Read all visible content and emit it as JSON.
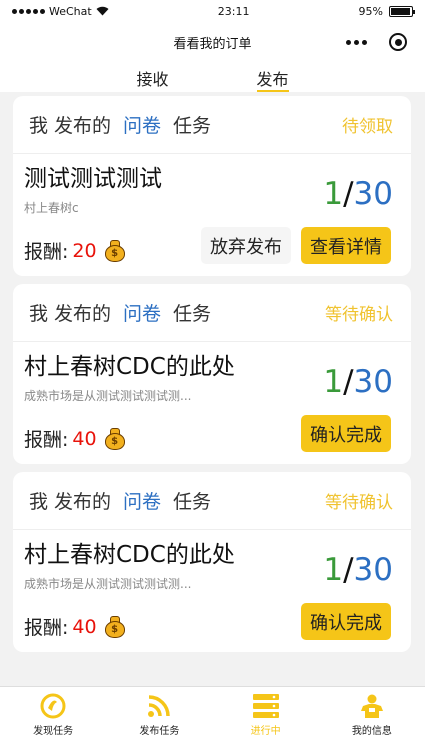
{
  "status_bar": {
    "carrier": "WeChat",
    "time": "23:11",
    "battery": "95%",
    "battery_level": 0.95
  },
  "nav": {
    "title": "看看我的订单"
  },
  "top_tabs": [
    {
      "label": "接收",
      "active": false
    },
    {
      "label": "发布",
      "active": true
    }
  ],
  "cards": [
    {
      "head": {
        "w1": "我",
        "w2": "发布的",
        "w3": "问卷",
        "w4": "任务",
        "status": "待领取"
      },
      "title": "测试测试测试",
      "subtitle": "村上春树c",
      "progress": {
        "done": "1",
        "slash": "/",
        "total": "30"
      },
      "reward_label": "报酬:",
      "reward_amount": "20",
      "buttons": [
        "放弃发布",
        "查看详情"
      ]
    },
    {
      "head": {
        "w1": "我",
        "w2": "发布的",
        "w3": "问卷",
        "w4": "任务",
        "status": "等待确认"
      },
      "title": "村上春树CDC的此处",
      "subtitle": "成熟市场是从测试测试测试测...",
      "progress": {
        "done": "1",
        "slash": "/",
        "total": "30"
      },
      "reward_label": "报酬:",
      "reward_amount": "40",
      "buttons": [
        "确认完成"
      ]
    },
    {
      "head": {
        "w1": "我",
        "w2": "发布的",
        "w3": "问卷",
        "w4": "任务",
        "status": "等待确认"
      },
      "title": "村上春树CDC的此处",
      "subtitle": "成熟市场是从测试测试测试测...",
      "progress": {
        "done": "1",
        "slash": "/",
        "total": "30"
      },
      "reward_label": "报酬:",
      "reward_amount": "40",
      "buttons": [
        "确认完成"
      ]
    }
  ],
  "tab_bar": [
    {
      "label": "发现任务",
      "icon": "discover-icon",
      "active": false
    },
    {
      "label": "发布任务",
      "icon": "rss-icon",
      "active": false
    },
    {
      "label": "进行中",
      "icon": "server-icon",
      "active": true
    },
    {
      "label": "我的信息",
      "icon": "profile-icon",
      "active": false
    }
  ],
  "colors": {
    "accent": "#f5c518",
    "blue": "#2c6fc2",
    "green": "#3a9a3a",
    "red": "#e8130b",
    "status": "#f0c330"
  }
}
